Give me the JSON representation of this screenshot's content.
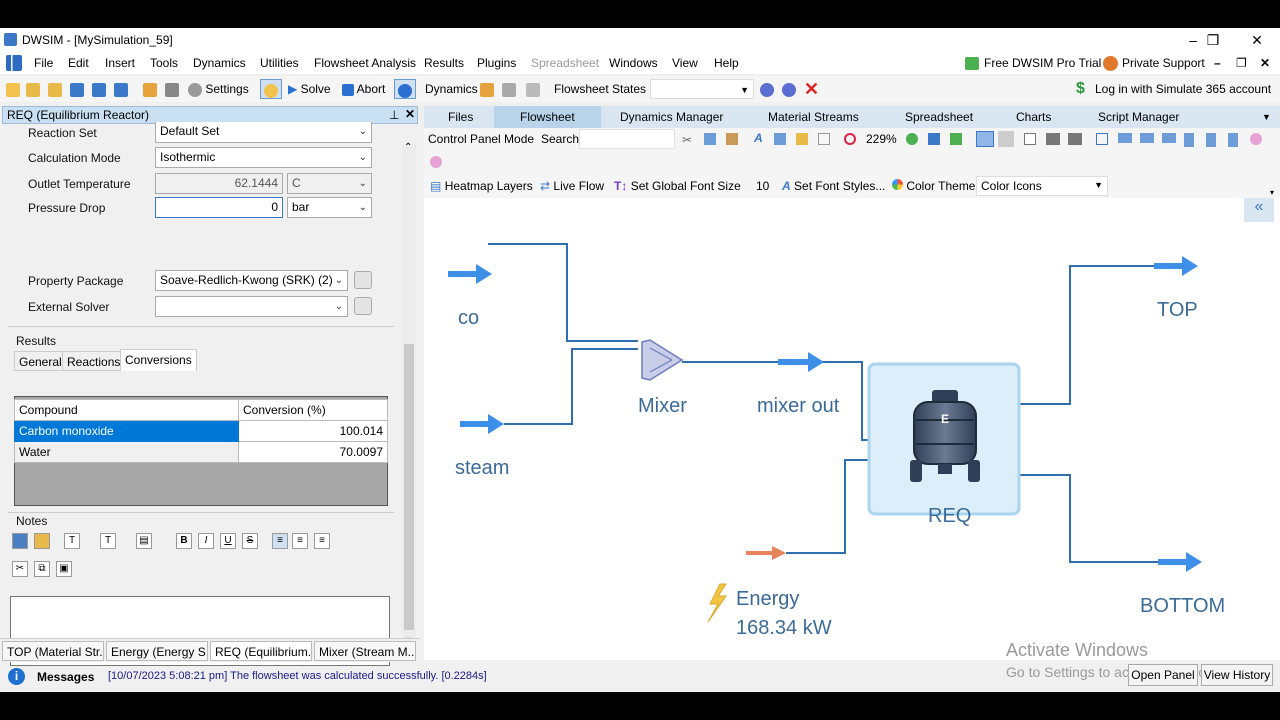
{
  "window": {
    "title": "DWSIM - [MySimulation_59]",
    "controls": [
      "–",
      "❐",
      "✕"
    ]
  },
  "menu": [
    "File",
    "Edit",
    "Insert",
    "Tools",
    "Dynamics",
    "Utilities",
    "Flowsheet Analysis",
    "Results",
    "Plugins",
    "Spreadsheet",
    "Windows",
    "View",
    "Help"
  ],
  "menu_right": {
    "pro_trial": "Free DWSIM Pro Trial",
    "support": "Private Support"
  },
  "toolbar": {
    "settings": "Settings",
    "solve": "Solve",
    "abort": "Abort",
    "dynamics": "Dynamics",
    "flowsheet_states": "Flowsheet States",
    "login": "Log in with Simulate 365 account"
  },
  "panel": {
    "title": "REQ (Equilibrium Reactor)",
    "reaction_set_label": "Reaction Set",
    "reaction_set_value": "Default Set",
    "calc_mode_label": "Calculation Mode",
    "calc_mode_value": "Isothermic",
    "outlet_temp_label": "Outlet Temperature",
    "outlet_temp_value": "62.1444",
    "outlet_temp_unit": "C",
    "pressure_drop_label": "Pressure Drop",
    "pressure_drop_value": "0",
    "pressure_drop_unit": "bar",
    "property_package_label": "Property Package",
    "property_package_value": "Soave-Redlich-Kwong (SRK) (2)",
    "external_solver_label": "External Solver",
    "external_solver_value": "",
    "results_label": "Results",
    "tabs": [
      "General",
      "Reactions",
      "Conversions"
    ],
    "table_headers": [
      "Compound",
      "Conversion (%)"
    ],
    "rows": [
      {
        "compound": "Carbon monoxide",
        "conversion": "100.014"
      },
      {
        "compound": "Water",
        "conversion": "70.0097"
      }
    ],
    "notes_label": "Notes"
  },
  "bottom_tabs": [
    "TOP (Material Str...",
    "Energy (Energy S...",
    "REQ (Equilibrium...",
    "Mixer (Stream M..."
  ],
  "right_tabs": [
    "Files",
    "Flowsheet",
    "Dynamics Manager",
    "Material Streams",
    "Spreadsheet",
    "Charts",
    "Script Manager"
  ],
  "control": {
    "mode": "Control Panel Mode",
    "search": "Search",
    "zoom": "229%",
    "heatmap": "Heatmap Layers",
    "liveflow": "Live Flow",
    "global_font": "Set Global Font Size",
    "font_size": "10",
    "font_styles": "Set Font Styles...",
    "color_theme": "Color Theme",
    "color_theme_value": "Color Icons"
  },
  "flowsheet": {
    "co": "co",
    "steam": "steam",
    "mixer": "Mixer",
    "mixer_out": "mixer out",
    "req": "REQ",
    "req_badge": "E",
    "top": "TOP",
    "bottom": "BOTTOM",
    "energy": "Energy",
    "energy_value": "168.34 kW"
  },
  "watermark": {
    "line1": "Activate Windows",
    "line2": "Go to Settings to activate Windows."
  },
  "buttons": {
    "open_panel": "Open Panel",
    "view_history": "View History"
  },
  "status": {
    "label": "Messages",
    "message": "[10/07/2023 5:08:21 pm] The flowsheet was calculated successfully. [0.2284s]"
  },
  "colors": {
    "stream": "#2f6fb0",
    "arrow": "#3d8fe8",
    "energy": "#e8845a",
    "accent": "#0078d7"
  }
}
